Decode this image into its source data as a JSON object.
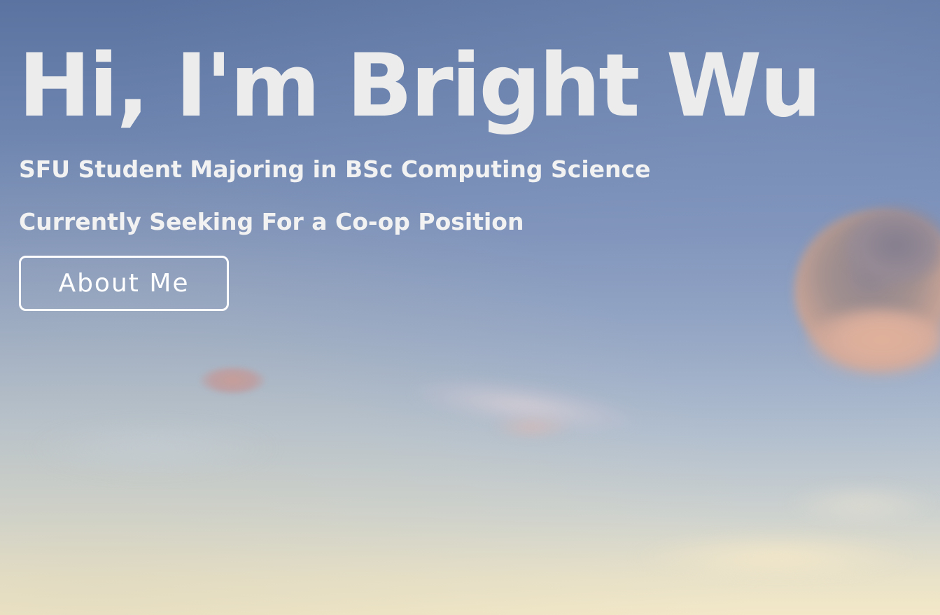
{
  "hero": {
    "title": "Hi, I'm Bright Wu",
    "subtitle_lines": [
      "SFU Student Majoring in BSc Computing Science",
      "Currently Seeking For a Co-op Position"
    ],
    "cta_label": "About Me",
    "text_color": "#ececec",
    "button_border_color": "#ffffff",
    "background": "sky-at-dusk-photo"
  }
}
